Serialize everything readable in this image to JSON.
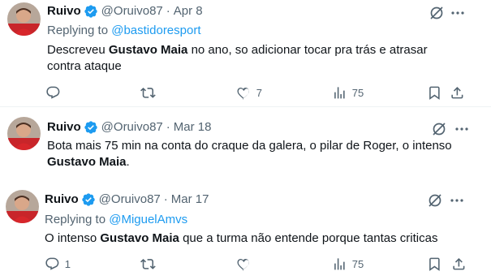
{
  "author": {
    "name": "Ruivo",
    "handle": "@Oruivo87",
    "separator": "·"
  },
  "tweets": [
    {
      "date": "Apr 8",
      "reply_prefix": "Replying to",
      "reply_to": "@bastidoresport",
      "text_part1": "Descreveu ",
      "text_bold": "Gustavo Maia",
      "text_part2": " no ano, so adicionar tocar pra trás e atrasar contra ataque",
      "replies": "",
      "retweets": "",
      "likes": "7",
      "views": "75"
    },
    {
      "date": "Mar 18",
      "text_part1": "Bota mais 75 min na conta do craque da galera, o pilar de Roger, o intenso ",
      "text_bold": "Gustavo Maia",
      "text_part2": "."
    },
    {
      "date": "Mar 17",
      "reply_prefix": "Replying to",
      "reply_to": "@MiguelAmvs",
      "text_part1": "O intenso ",
      "text_bold": "Gustavo Maia",
      "text_part2": " que a turma não entende porque tantas criticas",
      "replies": "1",
      "retweets": "",
      "likes": "",
      "views": "75"
    }
  ],
  "colors": {
    "accent": "#1d9bf0",
    "secondary": "#536471",
    "text": "#0f1419",
    "divider": "#eff3f4"
  },
  "icons": [
    "verified-badge-icon",
    "grok-icon",
    "more-icon",
    "reply-icon",
    "retweet-icon",
    "like-icon",
    "views-icon",
    "bookmark-icon",
    "share-icon"
  ]
}
